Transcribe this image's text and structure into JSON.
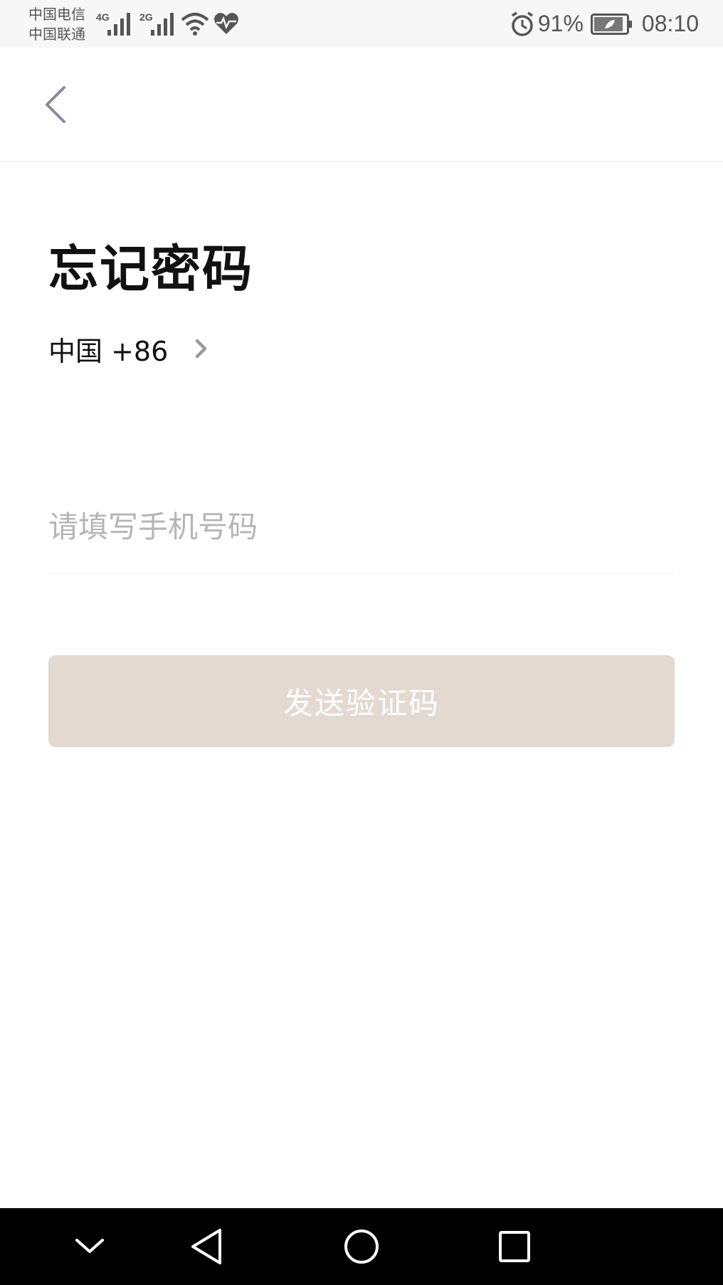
{
  "status_bar": {
    "carrier_1": "中国电信",
    "carrier_2": "中国联通",
    "network_1": "2G",
    "network_2": "4G",
    "battery_percent": "91%",
    "time": "08:10"
  },
  "page": {
    "title": "忘记密码",
    "country_code": "中国 +86",
    "phone_placeholder": "请填写手机号码",
    "phone_value": "",
    "send_button_label": "发送验证码"
  },
  "colors": {
    "button_disabled_bg": "#e3d9d0",
    "placeholder": "#b5b5b8",
    "back_arrow": "#8a8a99"
  },
  "icons": {
    "back": "back-arrow-icon",
    "country_chevron": "chevron-right-icon",
    "nav_collapse": "chevron-down-icon",
    "nav_back": "triangle-back-icon",
    "nav_home": "circle-home-icon",
    "nav_recents": "square-recents-icon"
  }
}
